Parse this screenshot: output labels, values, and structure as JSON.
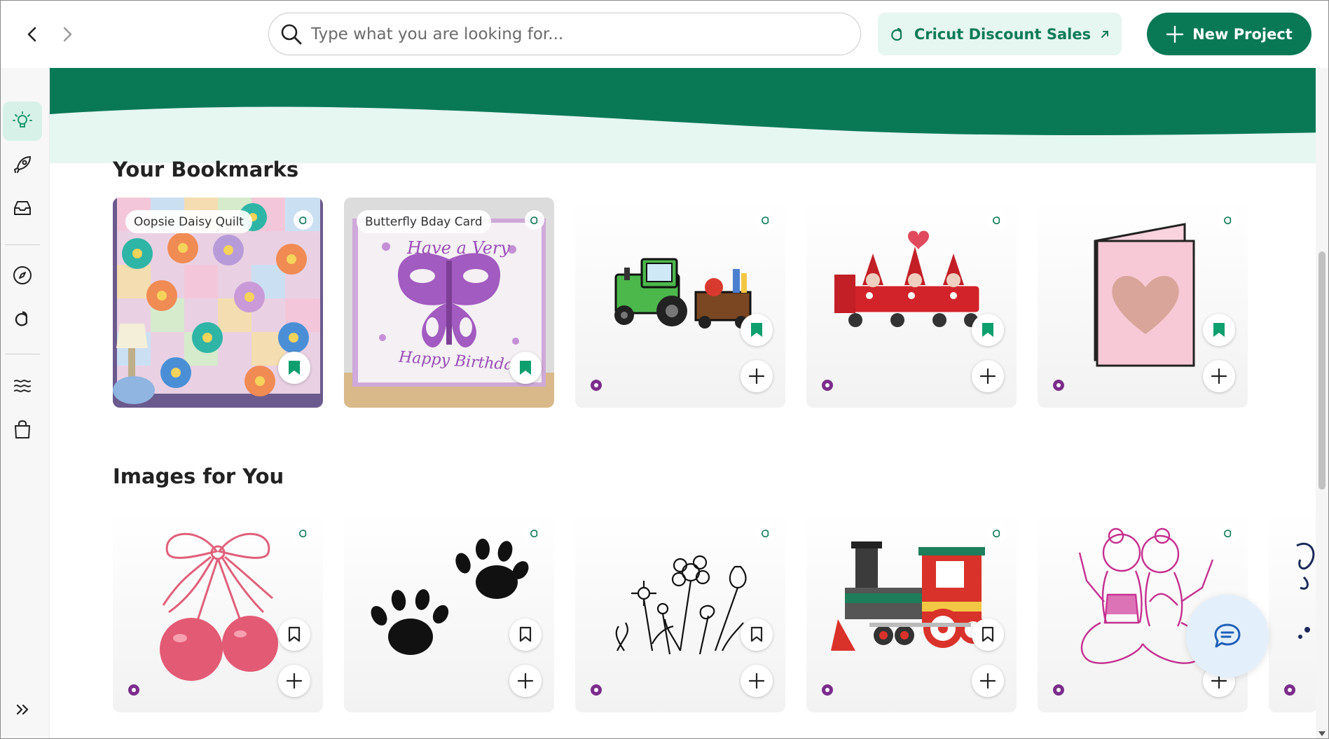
{
  "topbar": {
    "search_placeholder": "Type what you are looking for...",
    "discount_label": "Cricut Discount Sales",
    "new_project_label": "New Project"
  },
  "colors": {
    "brand_green": "#097955",
    "banner_light": "#e6f6f1",
    "premium_purple": "#7b2d8b"
  },
  "sidebar": {
    "items": [
      {
        "icon": "lightbulb-icon",
        "active": true
      },
      {
        "icon": "rocket-icon"
      },
      {
        "icon": "inbox-icon"
      },
      {
        "icon": "compass-icon"
      },
      {
        "icon": "cricut-logo-icon"
      },
      {
        "icon": "wave-icon"
      },
      {
        "icon": "shopping-bag-icon"
      }
    ],
    "expand_icon": "double-chevron-right-icon"
  },
  "bookmarks": {
    "title": "Your Bookmarks",
    "items": [
      {
        "label": "Oopsie Daisy Quilt",
        "image": "quilt-photo",
        "bookmarked": true
      },
      {
        "label": "Butterfly Bday Card",
        "image": "butterfly-card-photo",
        "bookmarked": true
      },
      {
        "image": "tractor-image",
        "bookmarked": true
      },
      {
        "image": "gnome-train-image",
        "bookmarked": true
      },
      {
        "image": "heart-card-image",
        "bookmarked": true
      }
    ]
  },
  "images_for_you": {
    "title": "Images for You",
    "items": [
      {
        "image": "cherry-bow-image"
      },
      {
        "image": "paw-prints-image"
      },
      {
        "image": "wildflowers-image"
      },
      {
        "image": "steam-train-image"
      },
      {
        "image": "best-friends-image"
      },
      {
        "image": "partial-image"
      }
    ]
  },
  "card_text": {
    "butterfly_top": "Have a Very",
    "butterfly_bottom": "Happy Birthday!"
  }
}
